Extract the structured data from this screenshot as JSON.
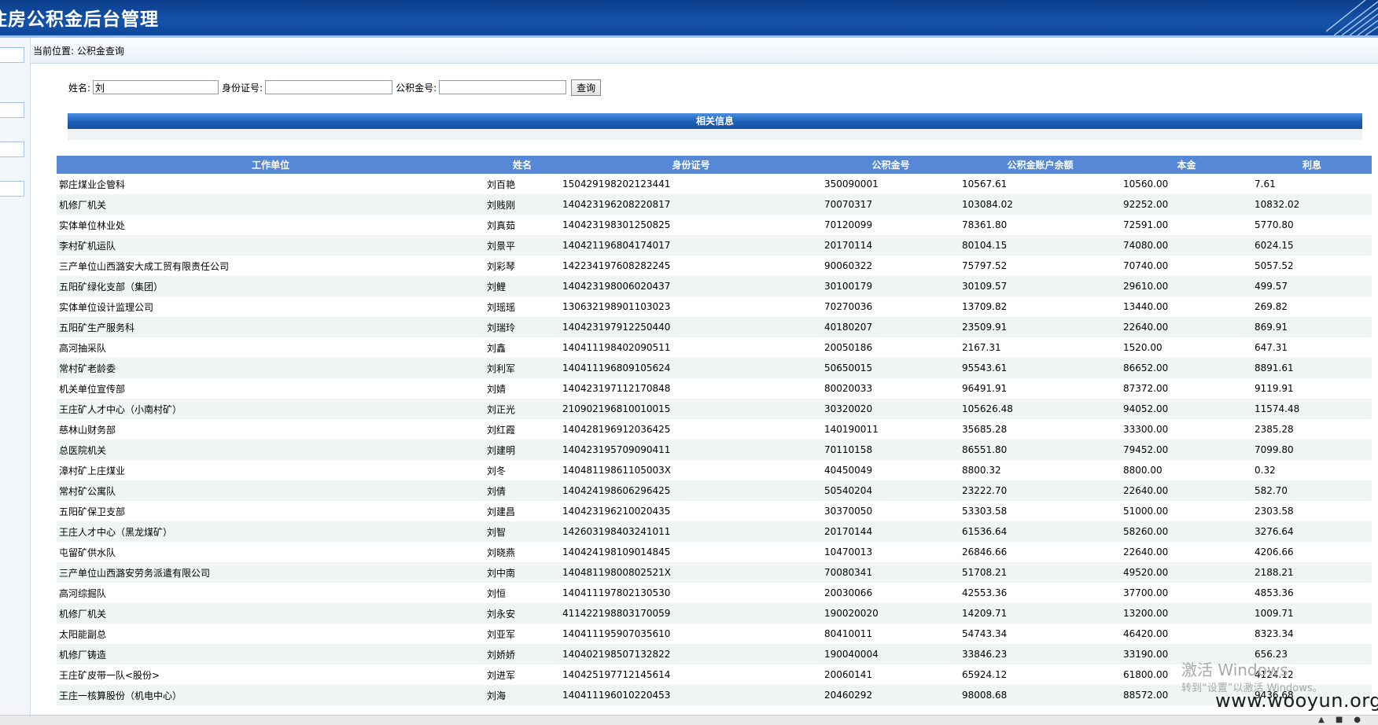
{
  "header": {
    "title": "住房公积金后台管理"
  },
  "breadcrumb": {
    "text": "当前位置: 公积金查询"
  },
  "search": {
    "name_label": "姓名:",
    "name_value": "刘",
    "id_label": "身份证号:",
    "id_value": "",
    "account_label": "公积金号:",
    "account_value": "",
    "query_button": "查询"
  },
  "section": {
    "title": "相关信息"
  },
  "table": {
    "headers": [
      "工作单位",
      "姓名",
      "身份证号",
      "公积金号",
      "公积金账户余额",
      "本金",
      "利息"
    ],
    "rows": [
      [
        "郭庄煤业企管科",
        "刘百艳",
        "150429198202123441",
        "350090001",
        "10567.61",
        "10560.00",
        "7.61"
      ],
      [
        "机修厂机关",
        "刘贱刚",
        "140423196208220817",
        "70070317",
        "103084.02",
        "92252.00",
        "10832.02"
      ],
      [
        "实体单位林业处",
        "刘真茹",
        "140423198301250825",
        "70120099",
        "78361.80",
        "72591.00",
        "5770.80"
      ],
      [
        "李村矿机运队",
        "刘景平",
        "140421196804174017",
        "20170114",
        "80104.15",
        "74080.00",
        "6024.15"
      ],
      [
        "三产单位山西潞安大成工贸有限责任公司",
        "刘彩琴",
        "142234197608282245",
        "90060322",
        "75797.52",
        "70740.00",
        "5057.52"
      ],
      [
        "五阳矿绿化支部（集团）",
        "刘鲤",
        "140423198006020437",
        "30100179",
        "30109.57",
        "29610.00",
        "499.57"
      ],
      [
        "实体单位设计监理公司",
        "刘瑶瑶",
        "130632198901103023",
        "70270036",
        "13709.82",
        "13440.00",
        "269.82"
      ],
      [
        "五阳矿生产服务科",
        "刘瑞玲",
        "140423197912250440",
        "40180207",
        "23509.91",
        "22640.00",
        "869.91"
      ],
      [
        "高河抽采队",
        "刘鑫",
        "140411198402090511",
        "20050186",
        "2167.31",
        "1520.00",
        "647.31"
      ],
      [
        "常村矿老龄委",
        "刘利军",
        "140411196809105624",
        "50650015",
        "95543.61",
        "86652.00",
        "8891.61"
      ],
      [
        "机关单位宣传部",
        "刘婧",
        "140423197112170848",
        "80020033",
        "96491.91",
        "87372.00",
        "9119.91"
      ],
      [
        "王庄矿人才中心（小南村矿）",
        "刘正光",
        "210902196810010015",
        "30320020",
        "105626.48",
        "94052.00",
        "11574.48"
      ],
      [
        "慈林山财务部",
        "刘红霞",
        "140428196912036425",
        "140190011",
        "35685.28",
        "33300.00",
        "2385.28"
      ],
      [
        "总医院机关",
        "刘建明",
        "140423195709090411",
        "70110158",
        "86551.80",
        "79452.00",
        "7099.80"
      ],
      [
        "漳村矿上庄煤业",
        "刘冬",
        "14048119861105003X",
        "40450049",
        "8800.32",
        "8800.00",
        "0.32"
      ],
      [
        "常村矿公寓队",
        "刘倩",
        "140424198606296425",
        "50540204",
        "23222.70",
        "22640.00",
        "582.70"
      ],
      [
        "五阳矿保卫支部",
        "刘建昌",
        "140423196210020435",
        "30370050",
        "53303.58",
        "51000.00",
        "2303.58"
      ],
      [
        "王庄人才中心（黑龙煤矿）",
        "刘智",
        "142603198403241011",
        "20170144",
        "61536.64",
        "58260.00",
        "3276.64"
      ],
      [
        "屯留矿供水队",
        "刘晓燕",
        "140424198109014845",
        "10470013",
        "26846.66",
        "22640.00",
        "4206.66"
      ],
      [
        "三产单位山西潞安劳务派遣有限公司",
        "刘中南",
        "14048119800802521X",
        "70080341",
        "51708.21",
        "49520.00",
        "2188.21"
      ],
      [
        "高河综掘队",
        "刘恒",
        "140411197802130530",
        "20030066",
        "42553.36",
        "37700.00",
        "4853.36"
      ],
      [
        "机修厂机关",
        "刘永安",
        "411422198803170059",
        "190020020",
        "14209.71",
        "13200.00",
        "1009.71"
      ],
      [
        "太阳能副总",
        "刘亚军",
        "140411195907035610",
        "80410011",
        "54743.34",
        "46420.00",
        "8323.34"
      ],
      [
        "机修厂铸造",
        "刘娇娇",
        "140402198507132822",
        "190040004",
        "33846.23",
        "33190.00",
        "656.23"
      ],
      [
        "王庄矿皮带一队<股份>",
        "刘进军",
        "140425197712145614",
        "20060141",
        "65924.12",
        "61800.00",
        "4124.12"
      ],
      [
        "王庄一核算股份（机电中心）",
        "刘海",
        "140411196010220453",
        "20460292",
        "98008.68",
        "88572.00",
        "9436.68"
      ]
    ]
  },
  "overlay": {
    "activate_title": "激活 Windows",
    "activate_sub": "转到“设置”以激活 Windows。",
    "site": "www.wooyun.org"
  }
}
